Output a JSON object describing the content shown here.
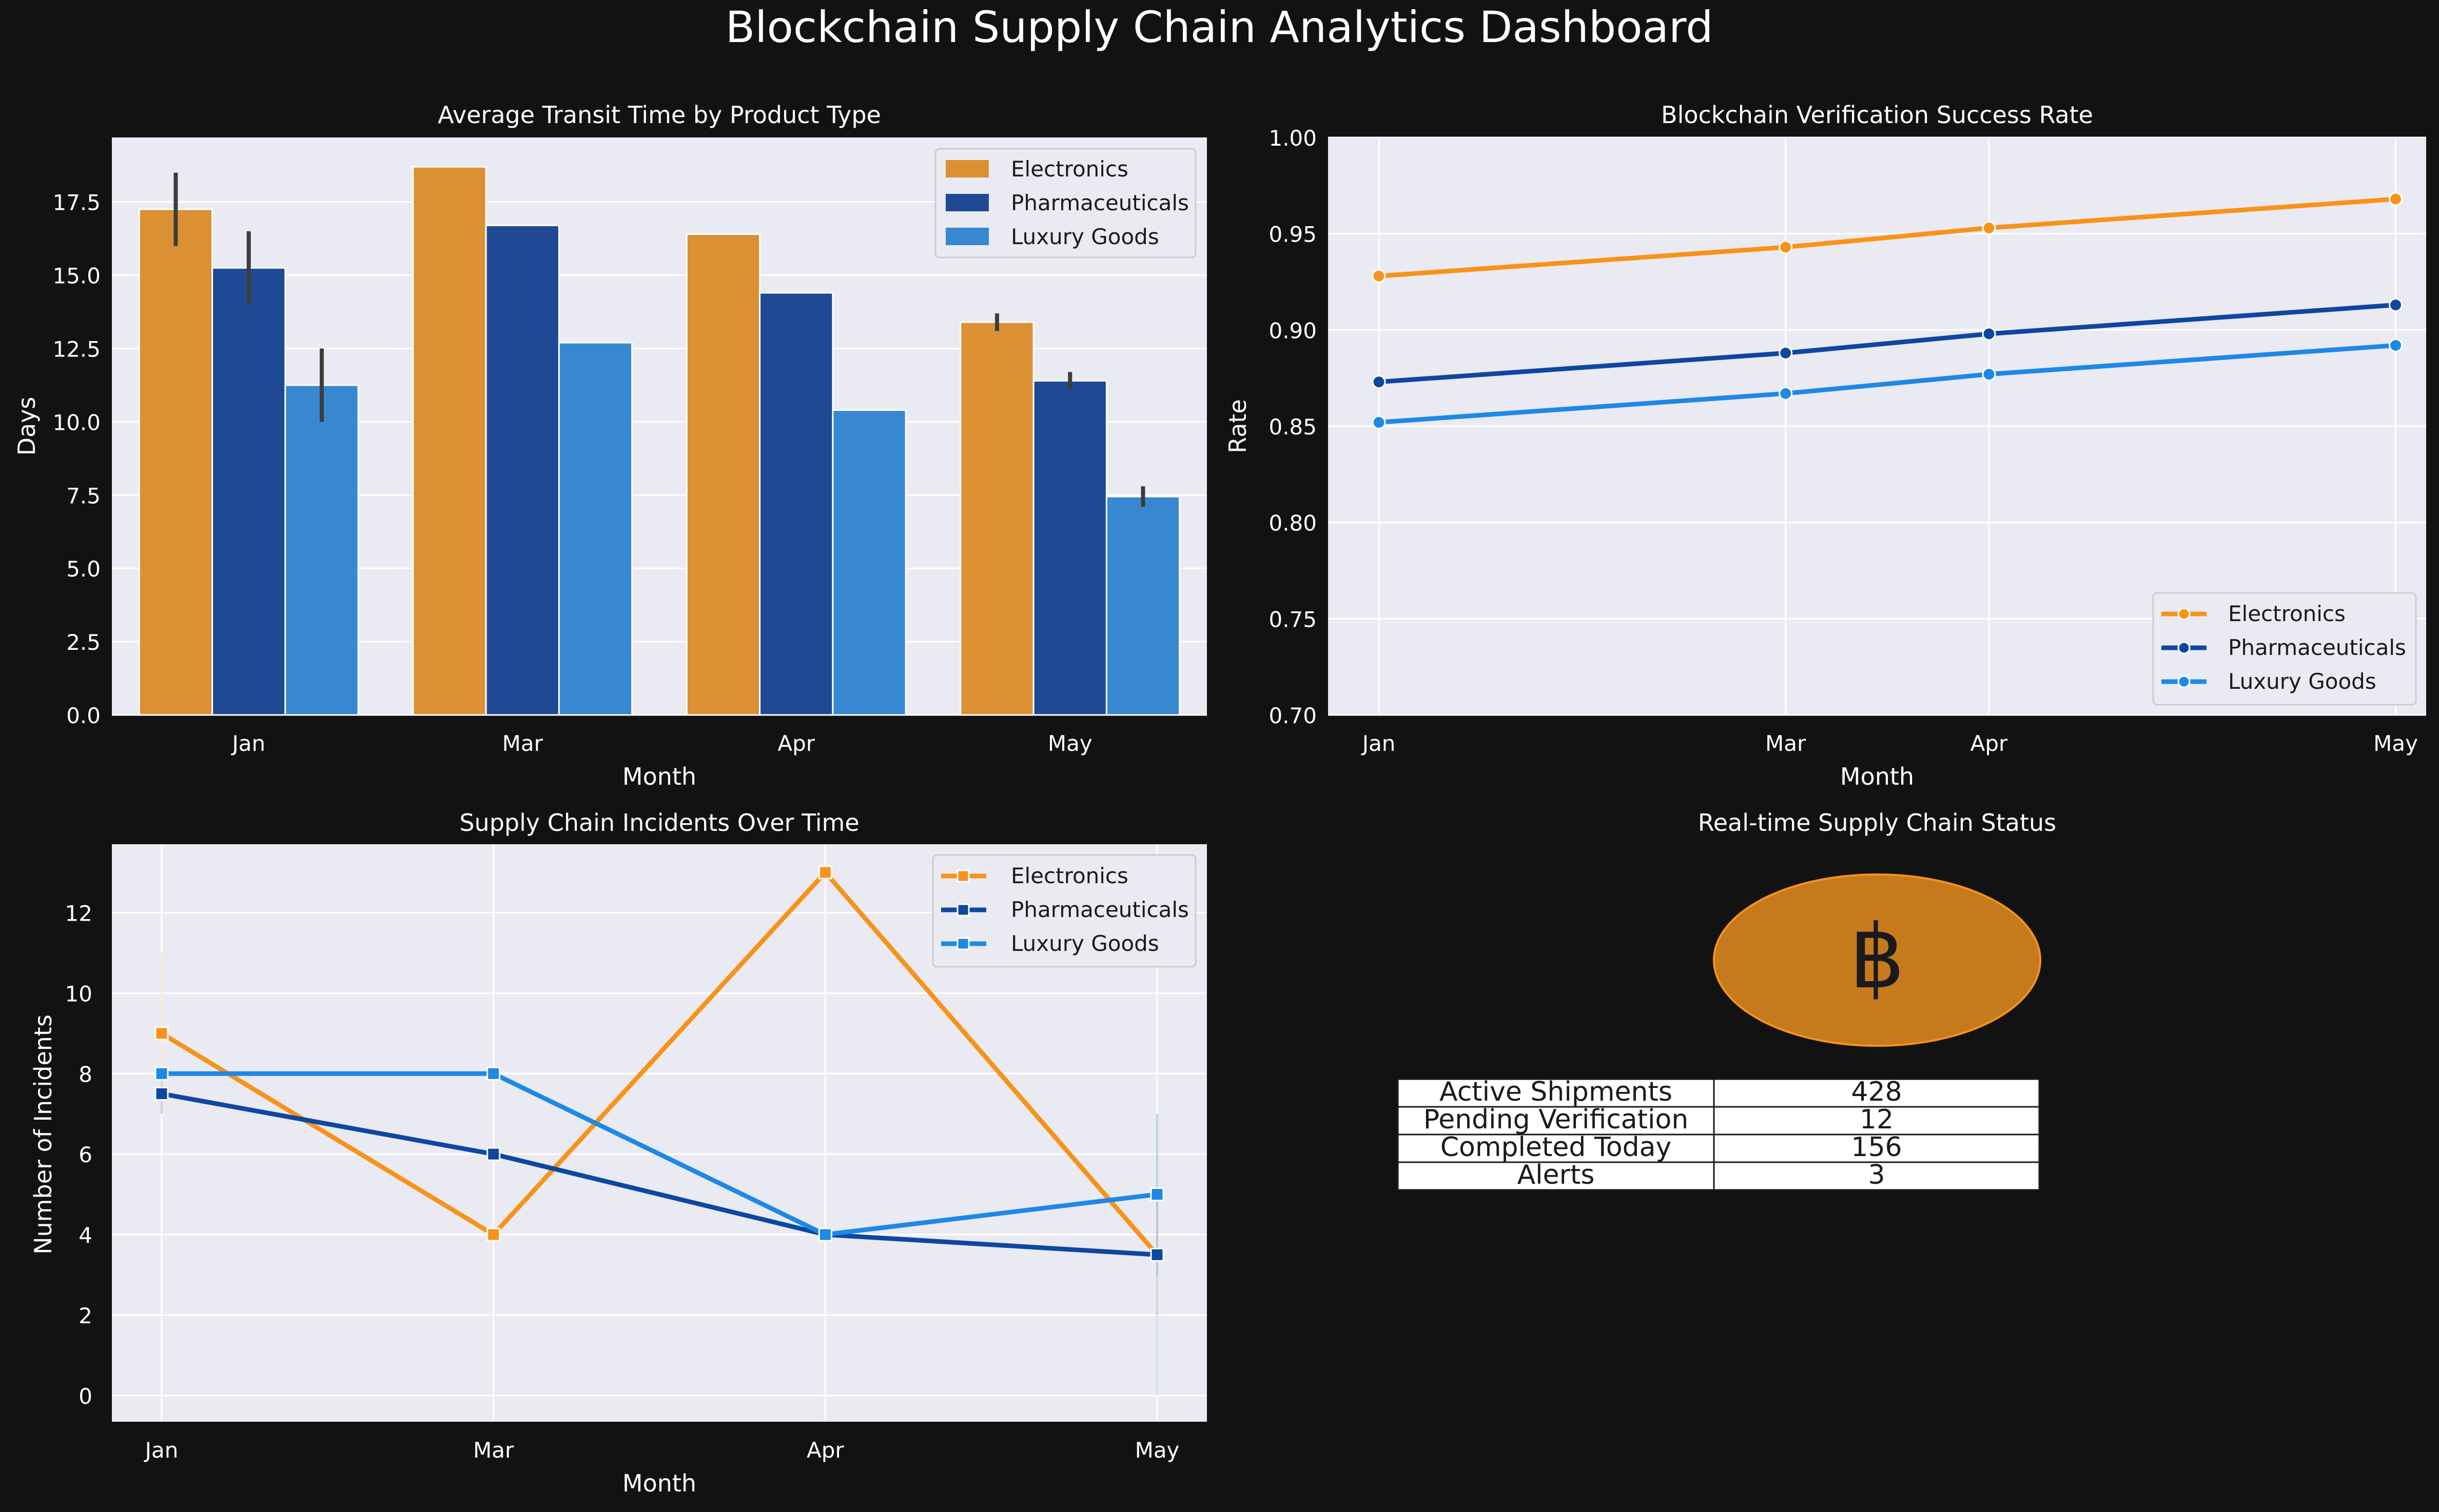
{
  "title": "Blockchain Supply Chain Analytics Dashboard",
  "colors": {
    "background": "#121212",
    "plot_bg": "#EAEAF2",
    "grid": "#FFFFFF",
    "text": "#FFFFFF",
    "electronics": "#F7931A",
    "pharmaceuticals": "#0D47A1",
    "luxury": "#1E88E5",
    "bar_electronics": "#DB9033",
    "bar_pharmaceuticals": "#1F4A93",
    "bar_luxury": "#3788D1",
    "coin": "#C67A1E",
    "coin_edge": "#F7931A"
  },
  "chart_data": [
    {
      "type": "bar",
      "title": "Average Transit Time by Product Type",
      "xlabel": "Month",
      "ylabel": "Days",
      "categories": [
        "Jan",
        "Mar",
        "Apr",
        "May"
      ],
      "ylim": [
        0,
        19.7
      ],
      "yticks": [
        0,
        2.5,
        5,
        7.5,
        10,
        12.5,
        15,
        17.5
      ],
      "ytick_labels": [
        "0.0",
        "2.5",
        "5.0",
        "7.5",
        "10.0",
        "12.5",
        "15.0",
        "17.5"
      ],
      "grid": true,
      "legend": "top-right",
      "series": [
        {
          "name": "Electronics",
          "values": [
            17.25,
            18.7,
            16.4,
            13.4
          ],
          "err_low": [
            16.0,
            null,
            null,
            13.1
          ],
          "err_high": [
            18.5,
            null,
            null,
            13.7
          ]
        },
        {
          "name": "Pharmaceuticals",
          "values": [
            15.25,
            16.7,
            14.4,
            11.4
          ],
          "err_low": [
            14.0,
            null,
            null,
            11.1
          ],
          "err_high": [
            16.5,
            null,
            null,
            11.7
          ]
        },
        {
          "name": "Luxury Goods",
          "values": [
            11.25,
            12.7,
            10.4,
            7.45
          ],
          "err_low": [
            10.0,
            null,
            null,
            7.1
          ],
          "err_high": [
            12.5,
            null,
            null,
            7.8
          ]
        }
      ]
    },
    {
      "type": "line",
      "title": "Blockchain Verification Success Rate",
      "xlabel": "Month",
      "ylabel": "Rate",
      "categories": [
        "Jan",
        "Mar",
        "Apr",
        "May"
      ],
      "x": [
        0,
        2,
        3,
        5
      ],
      "ylim": [
        0.7,
        1.0
      ],
      "yticks": [
        0.7,
        0.75,
        0.8,
        0.85,
        0.9,
        0.95,
        1.0
      ],
      "ytick_labels": [
        "0.70",
        "0.75",
        "0.80",
        "0.85",
        "0.90",
        "0.95",
        "1.00"
      ],
      "marker": "circle",
      "grid": true,
      "legend": "bottom-right",
      "series": [
        {
          "name": "Electronics",
          "values": [
            0.928,
            0.943,
            0.953,
            0.968
          ]
        },
        {
          "name": "Pharmaceuticals",
          "values": [
            0.873,
            0.888,
            0.898,
            0.913
          ]
        },
        {
          "name": "Luxury Goods",
          "values": [
            0.852,
            0.867,
            0.877,
            0.892
          ]
        }
      ]
    },
    {
      "type": "line",
      "title": "Supply Chain Incidents Over Time",
      "xlabel": "Month",
      "ylabel": "Number of Incidents",
      "categories": [
        "Jan",
        "Mar",
        "Apr",
        "May"
      ],
      "x": [
        0,
        2,
        4,
        6
      ],
      "ylim": [
        -0.65,
        13.7
      ],
      "yticks": [
        0,
        2,
        4,
        6,
        8,
        10,
        12
      ],
      "ytick_labels": [
        "0",
        "2",
        "4",
        "6",
        "8",
        "10",
        "12"
      ],
      "marker": "square",
      "grid": true,
      "legend": "top-right",
      "series": [
        {
          "name": "Electronics",
          "values": [
            9,
            4,
            13,
            3.5
          ],
          "band_low": [
            7,
            null,
            null,
            2
          ],
          "band_high": [
            11,
            null,
            null,
            5
          ]
        },
        {
          "name": "Pharmaceuticals",
          "values": [
            7.5,
            6,
            4,
            3.5
          ],
          "band_low": [
            7,
            null,
            null,
            0
          ],
          "band_high": [
            8,
            null,
            null,
            7
          ]
        },
        {
          "name": "Luxury Goods",
          "values": [
            8,
            8,
            4,
            5
          ],
          "band_low": [
            null,
            null,
            null,
            3
          ],
          "band_high": [
            null,
            null,
            null,
            7
          ]
        }
      ]
    },
    {
      "type": "table",
      "title": "Real-time Supply Chain Status",
      "icon": "bitcoin-icon",
      "icon_glyph": "฿",
      "rows": [
        [
          "Active Shipments",
          "428"
        ],
        [
          "Pending Verification",
          "12"
        ],
        [
          "Completed Today",
          "156"
        ],
        [
          "Alerts",
          "3"
        ]
      ]
    }
  ]
}
